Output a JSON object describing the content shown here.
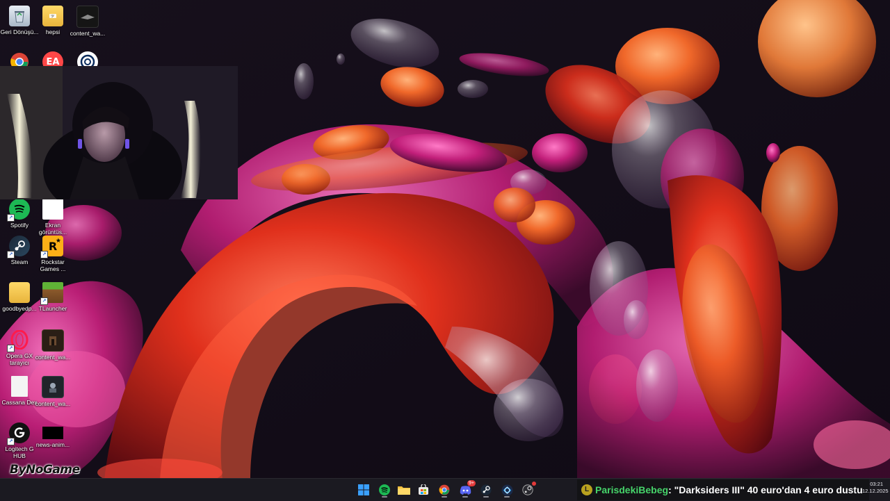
{
  "desktop": {
    "icons": [
      {
        "label": "Geri Dönüşü...",
        "icon": "recycle-bin-icon"
      },
      {
        "label": "hepsi",
        "icon": "folder-icon"
      },
      {
        "label": "content_wa...",
        "icon": "video-thumbnail-icon"
      },
      {
        "label": "",
        "icon": "chrome-icon"
      },
      {
        "label": "",
        "icon": "ea-icon"
      },
      {
        "label": "",
        "icon": "ubisoft-icon"
      },
      {
        "label": "Spotify",
        "icon": "spotify-icon"
      },
      {
        "label": "Ekran görüntüs...",
        "icon": "screenshot-file-icon"
      },
      {
        "label": "Steam",
        "icon": "steam-icon"
      },
      {
        "label": "Rockstar Games ...",
        "icon": "rockstar-icon"
      },
      {
        "label": "goodbyedp...",
        "icon": "folder-icon"
      },
      {
        "label": "TLauncher",
        "icon": "tlauncher-icon"
      },
      {
        "label": "Opera GX tarayıcı",
        "icon": "opera-gx-icon"
      },
      {
        "label": "content_wa...",
        "icon": "video-thumbnail-icon"
      },
      {
        "label": "Cassana Dex",
        "icon": "document-icon"
      },
      {
        "label": "content_wa...",
        "icon": "video-thumbnail-icon"
      },
      {
        "label": "Logitech G HUB",
        "icon": "logitech-g-hub-icon"
      },
      {
        "label": "news-anim...",
        "icon": "video-thumbnail-icon"
      }
    ]
  },
  "watermark": {
    "text": "ByNoGame"
  },
  "taskbar": {
    "apps": [
      {
        "name": "Start",
        "icon": "windows-start-icon"
      },
      {
        "name": "Spotify",
        "icon": "spotify-icon"
      },
      {
        "name": "File Explorer",
        "icon": "file-explorer-icon"
      },
      {
        "name": "Microsoft Store",
        "icon": "store-icon"
      },
      {
        "name": "Google Chrome",
        "icon": "chrome-icon"
      },
      {
        "name": "Discord",
        "icon": "discord-icon",
        "badge": "9+"
      },
      {
        "name": "Steam",
        "icon": "steam-icon"
      },
      {
        "name": "Battle.net",
        "icon": "battlenet-icon"
      },
      {
        "name": "Steam overlay",
        "icon": "steam-icon"
      }
    ],
    "clock": {
      "time": "03:21",
      "date": "12.12.2025"
    }
  },
  "ticker": {
    "badge": "L",
    "user": "ParisdekiBebeg",
    "message": " : \"Darksiders III\" 40 euro'dan 4 euro dustu"
  },
  "colors": {
    "background": "#130d18",
    "taskbar": "#1b1a21",
    "ticker_user": "#46d46a",
    "wallpaper_orange": "#e8642a",
    "wallpaper_magenta": "#c21f7a"
  }
}
